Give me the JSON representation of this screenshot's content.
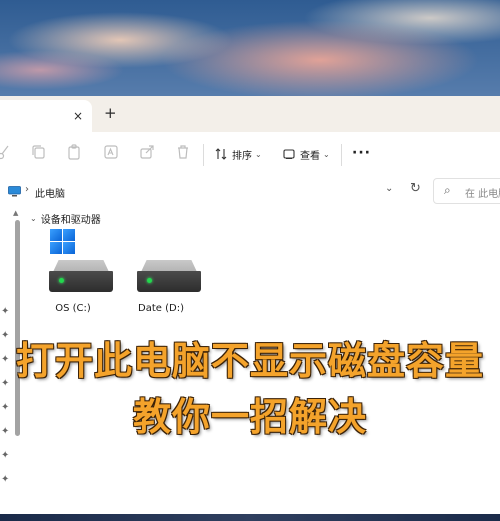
{
  "tabs": {
    "close_label": "×",
    "add_label": "+"
  },
  "toolbar": {
    "sort_label": "排序",
    "view_label": "查看",
    "more_label": "···"
  },
  "address": {
    "chevron": "›",
    "path": "此电脑",
    "dropdown": "⌄",
    "refresh": "↻"
  },
  "search": {
    "placeholder": "在 此电脑"
  },
  "devices": {
    "group_title": "设备和驱动器",
    "drives": [
      {
        "label": "OS (C:)"
      },
      {
        "label": "Date (D:)"
      }
    ]
  },
  "overlay": {
    "line1": "打开此电脑不显示磁盘容量",
    "line2": "教你一招解决"
  },
  "colors": {
    "overlay_text": "#f4a32b",
    "overlay_stroke": "#3b2208",
    "drive_led": "#22d84d",
    "windows_blue": "#0a64d6"
  }
}
